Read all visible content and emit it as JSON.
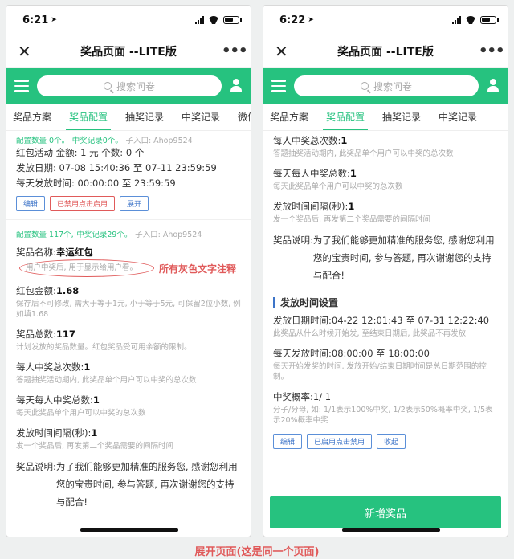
{
  "nav": {
    "title": "奖品页面 --LITE版",
    "search_placeholder": "搜索问卷"
  },
  "tabs": [
    "奖品方案",
    "奖品配置",
    "抽奖记录",
    "中奖记录",
    "微信文"
  ],
  "colors": {
    "accent": "#26c27f",
    "annotation": "#e05a5a",
    "link": "#3d74c8"
  },
  "phone1": {
    "time": "6:21",
    "card1": {
      "stats_prize": "配置数量 0个。",
      "stats_win": "中奖记录0个。",
      "stats_entry": "子入口: Ahop9524",
      "line1": "红包活动  金额: 1 元  个数: 0 个",
      "line2": "发放日期: 07-08 15:40:36 至 07-11 23:59:59",
      "line3": "每天发放时间: 00:00:00 至 23:59:59",
      "btn_edit": "编辑",
      "btn_disabled": "已禁用点击启用",
      "btn_expand": "展开"
    },
    "card2": {
      "stats_prize": "配置数量 117个,",
      "stats_win": "中奖记录29个。",
      "stats_entry": "子入口: Ahop9524",
      "name_label": "奖品名称:",
      "name_value": "幸运红包",
      "name_note": "用户中奖后, 用于显示给用户看。",
      "annotation": "所有灰色文字注释",
      "amount_label": "红包金额:",
      "amount_value": "1.68",
      "amount_note": "保存后不可修改, 需大于等于1元, 小于等于5元, 可保留2位小数, 例如填1.68",
      "total_label": "奖品总数:",
      "total_value": "117",
      "total_note": "计划发放的奖品数量。红包奖品受可用余额的限制。",
      "per_user_label": "每人中奖总次数:",
      "per_user_value": "1",
      "per_user_note": "答题抽奖活动期内, 此奖品单个用户可以中奖的总次数",
      "per_day_label": "每天每人中奖总数:",
      "per_day_value": "1",
      "per_day_note": "每天此奖品单个用户可以中奖的总次数",
      "interval_label": "发放时间间隔(秒):",
      "interval_value": "1",
      "interval_note": "发一个奖品后, 再发第二个奖品需要的间隔时间",
      "desc_label": "奖品说明:",
      "desc_value": "为了我们能够更加精准的服务您, 感谢您利用您的宝贵时间, 参与答题, 再次谢谢您的支持与配合!"
    }
  },
  "phone2": {
    "time": "6:22",
    "per_user_label": "每人中奖总次数:",
    "per_user_value": "1",
    "per_user_note": "答题抽奖活动期内, 此奖品单个用户可以中奖的总次数",
    "per_day_label": "每天每人中奖总数:",
    "per_day_value": "1",
    "per_day_note": "每天此奖品单个用户可以中奖的总次数",
    "interval_label": "发放时间间隔(秒):",
    "interval_value": "1",
    "interval_note": "发一个奖品后, 再发第二个奖品需要的间隔时间",
    "desc_label": "奖品说明:",
    "desc_value": "为了我们能够更加精准的服务您, 感谢您利用您的宝贵时间, 参与答题, 再次谢谢您的支持与配合!",
    "section_title": "发放时间设置",
    "date_label": "发放日期时间:",
    "date_value": "04-22 12:01:43 至 07-31 12:22:40",
    "date_note": "此奖品从什么时候开始发, 至结束日期后, 此奖品不再发放",
    "daily_label": "每天发放时间:",
    "daily_value": "08:00:00 至 18:00:00",
    "daily_note": "每天开始发奖的时间, 发放开始/结束日期时间是总日期范围的控制。",
    "prob_label": "中奖概率:",
    "prob_value": "1/ 1",
    "prob_note": "分子/分母, 如: 1/1表示100%中奖, 1/2表示50%概率中奖, 1/5表示20%概率中奖",
    "btn_edit": "编辑",
    "btn_enabled": "已启用点击禁用",
    "btn_collapse": "收起",
    "add_button": "新增奖品"
  },
  "caption": "展开页面(这是同一个页面)"
}
